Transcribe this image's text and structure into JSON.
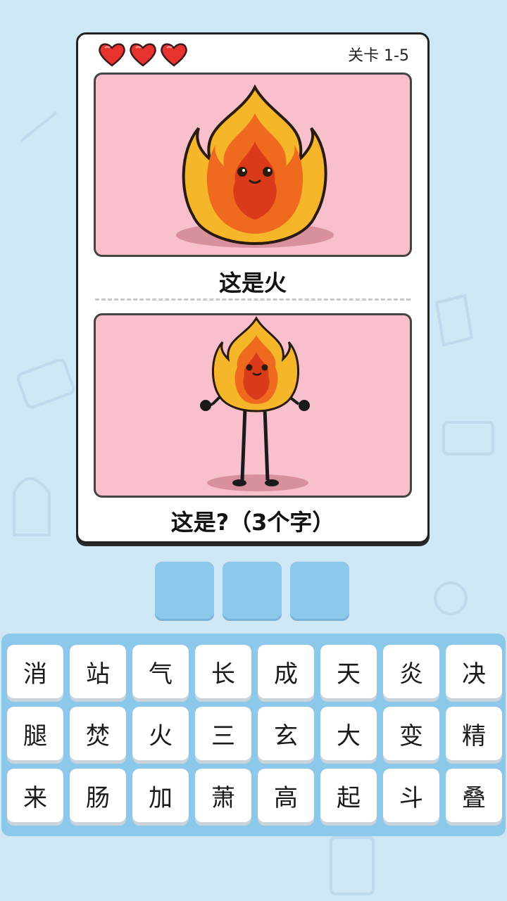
{
  "header": {
    "lives": 3,
    "level_label": "关卡 1-5"
  },
  "question": {
    "example_caption": "这是火",
    "prompt_caption": "这是?（3个字）",
    "answer_slots": [
      "",
      "",
      ""
    ]
  },
  "keyboard": {
    "keys": [
      "消",
      "站",
      "气",
      "长",
      "成",
      "天",
      "炎",
      "决",
      "腿",
      "焚",
      "火",
      "三",
      "玄",
      "大",
      "变",
      "精",
      "来",
      "肠",
      "加",
      "萧",
      "高",
      "起",
      "斗",
      "叠"
    ]
  },
  "icons": {
    "life": "heart-icon",
    "example_image": "fire-character-icon",
    "prompt_image": "fire-with-legs-icon"
  },
  "colors": {
    "background": "#cfe8f6",
    "panel": "#f7c0cc",
    "heart": "#e8322e",
    "slot": "#8cc8ea"
  }
}
